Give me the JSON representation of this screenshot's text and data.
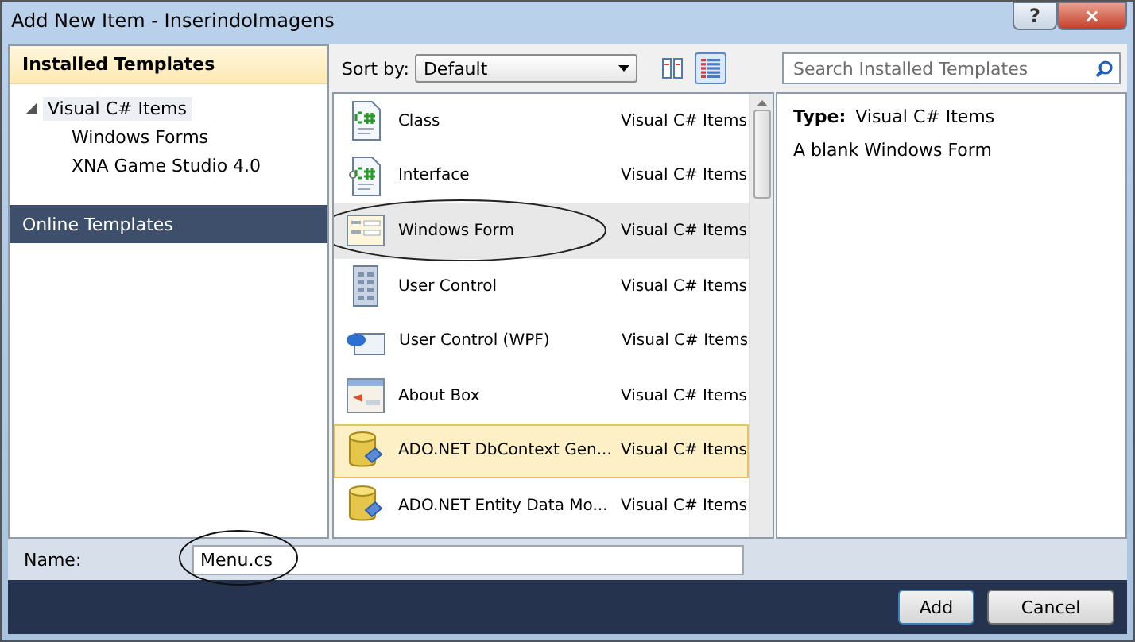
{
  "window": {
    "title": "Add New Item - InserindoImagens",
    "buttons": [
      {
        "kind": "help",
        "label": "?"
      },
      {
        "kind": "close",
        "label": "×"
      }
    ]
  },
  "sidebar": {
    "installed_header": "Installed Templates",
    "tree": [
      {
        "label": "Visual C# Items",
        "expanded": true,
        "selected": true,
        "children": [
          {
            "label": "Windows Forms",
            "selected": false
          },
          {
            "label": "XNA Game Studio 4.0",
            "selected": false
          }
        ]
      }
    ],
    "online_header": "Online Templates"
  },
  "sort": {
    "label": "Sort by:",
    "value": "Default"
  },
  "views": [
    {
      "kind": "medium",
      "selected": false
    },
    {
      "kind": "small",
      "selected": true
    }
  ],
  "search": {
    "placeholder": "Search Installed Templates"
  },
  "items": [
    {
      "name": "Class",
      "category": "Visual C# Items",
      "kind": "class",
      "selected": false,
      "hovered": false
    },
    {
      "name": "Interface",
      "category": "Visual C# Items",
      "kind": "interface",
      "selected": false,
      "hovered": false
    },
    {
      "name": "Windows Form",
      "category": "Visual C# Items",
      "kind": "form",
      "selected": true,
      "hovered": false,
      "circled": true
    },
    {
      "name": "User Control",
      "category": "Visual C# Items",
      "kind": "control",
      "selected": false,
      "hovered": false
    },
    {
      "name": "User Control (WPF)",
      "category": "Visual C# Items",
      "kind": "wpf",
      "selected": false,
      "hovered": false
    },
    {
      "name": "About Box",
      "category": "Visual C# Items",
      "kind": "about",
      "selected": false,
      "hovered": false
    },
    {
      "name": "ADO.NET DbContext Gen...",
      "category": "Visual C# Items",
      "kind": "db",
      "selected": false,
      "hovered": true
    },
    {
      "name": "ADO.NET Entity Data Mo...",
      "category": "Visual C# Items",
      "kind": "db",
      "selected": false,
      "hovered": false
    }
  ],
  "details": {
    "type_label": "Type:",
    "type_value": "Visual C# Items",
    "description": "A blank Windows Form"
  },
  "name_field": {
    "label": "Name:",
    "value": "Menu.cs",
    "circled": true
  },
  "buttons": [
    {
      "label": "Add",
      "default": true
    },
    {
      "label": "Cancel",
      "default": false
    }
  ]
}
